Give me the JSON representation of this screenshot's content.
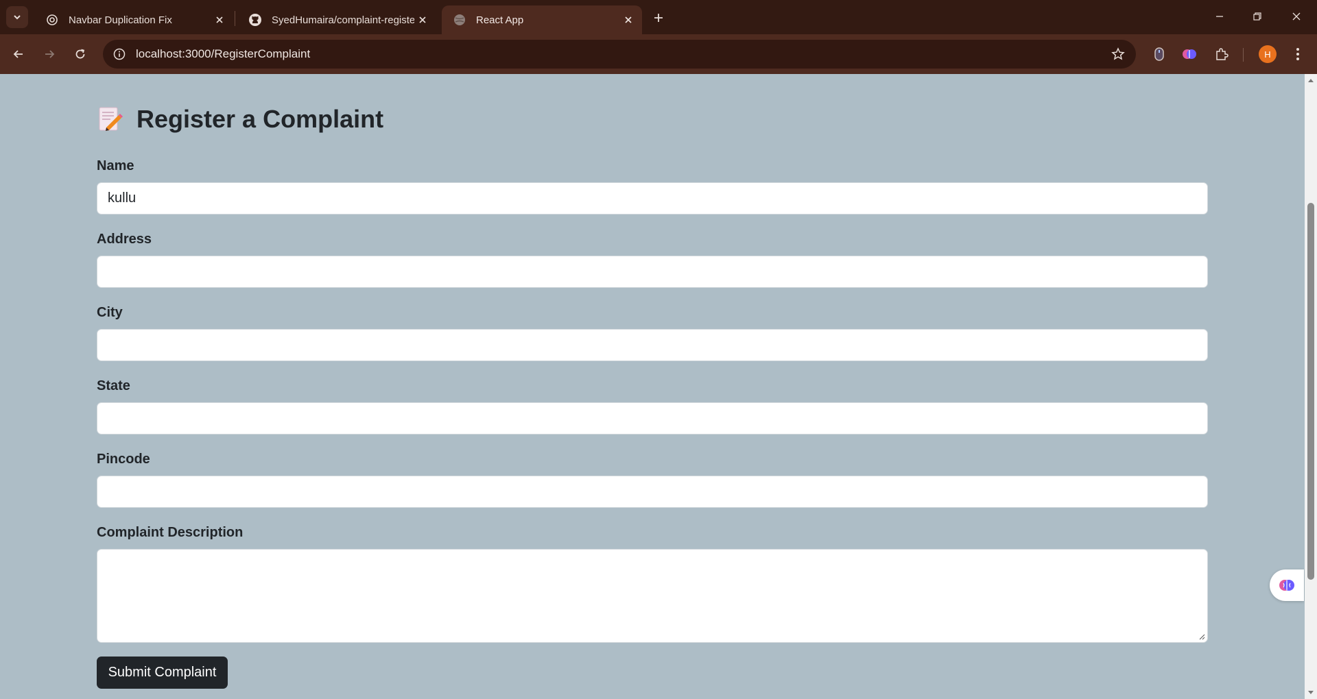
{
  "browser": {
    "tabs": [
      {
        "title": "Navbar Duplication Fix",
        "icon": "openai-icon",
        "active": false
      },
      {
        "title": "SyedHumaira/complaint-registe",
        "icon": "github-icon",
        "active": false
      },
      {
        "title": "React App",
        "icon": "globe-icon",
        "active": true
      }
    ],
    "url": "localhost:3000/RegisterComplaint",
    "profile_initial": "H"
  },
  "form": {
    "title": "Register a Complaint",
    "title_icon": "memo-icon",
    "fields": {
      "name": {
        "label": "Name",
        "value": "kullu"
      },
      "address": {
        "label": "Address",
        "value": ""
      },
      "city": {
        "label": "City",
        "value": ""
      },
      "state": {
        "label": "State",
        "value": ""
      },
      "pincode": {
        "label": "Pincode",
        "value": ""
      },
      "description": {
        "label": "Complaint Description",
        "value": ""
      }
    },
    "submit_label": "Submit Complaint"
  },
  "colors": {
    "page_background": "#adbdc6",
    "button_background": "#212529",
    "browser_frame": "#331a12",
    "browser_toolbar": "#4e2a1f"
  }
}
